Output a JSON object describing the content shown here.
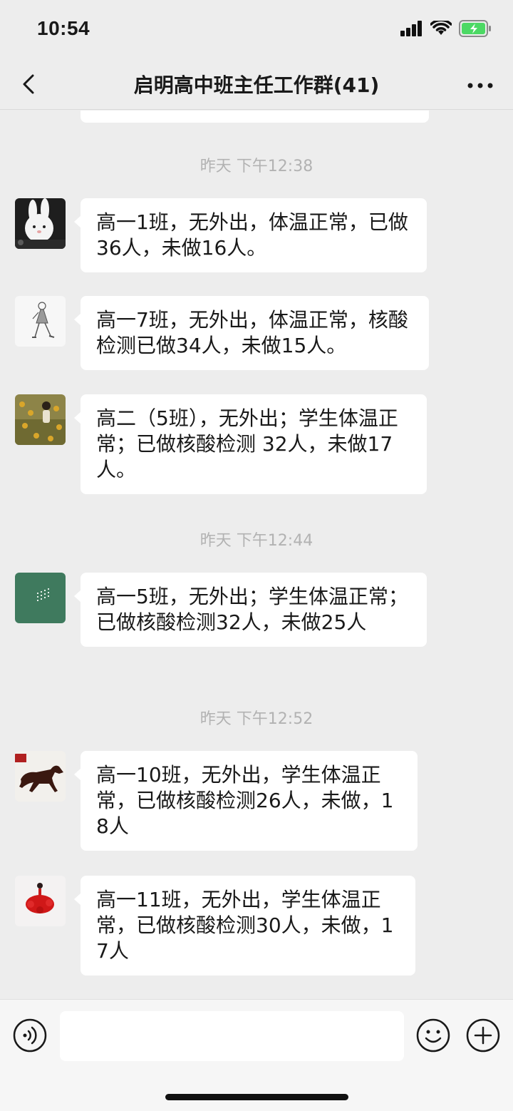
{
  "status_bar": {
    "time": "10:54"
  },
  "nav": {
    "title": "启明高中班主任工作群(41)"
  },
  "messages": [
    {
      "type": "timestamp",
      "text": "昨天 下午12:38"
    },
    {
      "type": "message",
      "avatar": "rabbit-avatar",
      "text": "高一1班，无外出，体温正常，已做36人，未做16人。"
    },
    {
      "type": "message",
      "avatar": "sketch-girl-avatar",
      "text": "高一7班，无外出，体温正常，核酸检测已做34人，未做15人。"
    },
    {
      "type": "message",
      "avatar": "flower-field-avatar",
      "text": "高二（5班），无外出；学生体温正常；已做核酸检测 32人，未做17人。"
    },
    {
      "type": "timestamp",
      "text": "昨天 下午12:44"
    },
    {
      "type": "message",
      "avatar": "green-poem-avatar",
      "text": "高一5班，无外出；学生体温正常；已做核酸检测32人，未做25人"
    },
    {
      "type": "timestamp",
      "text": "昨天 下午12:52"
    },
    {
      "type": "message",
      "avatar": "horse-avatar",
      "text": "高一10班，无外出，学生体温正常，已做核酸检测26人，未做，18人"
    },
    {
      "type": "message",
      "avatar": "red-dress-avatar",
      "text": "高一11班，无外出，学生体温正常，已做核酸检测30人，未做，17人"
    }
  ],
  "input_bar": {
    "placeholder": ""
  },
  "colors": {
    "background": "#ededed",
    "bubble": "#ffffff",
    "timestamp": "#b2b2b2",
    "battery": "#4cd964"
  }
}
